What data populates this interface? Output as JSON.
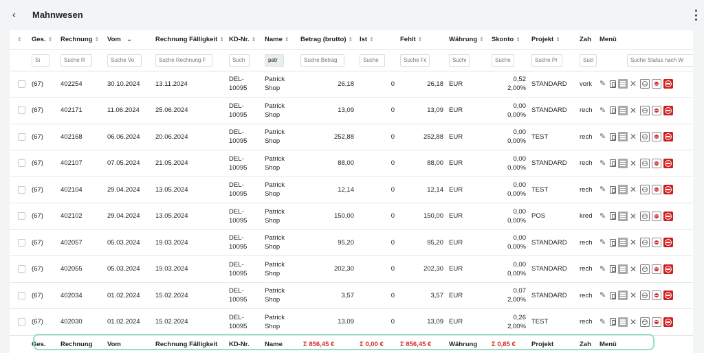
{
  "header": {
    "title": "Mahnwesen",
    "back_symbol": "‹"
  },
  "columns": {
    "ges": "Ges.",
    "rechnung": "Rechnung",
    "vom": "Vom",
    "faelligkeit": "Rechnung Fälligkeit",
    "kd": "KD-Nr.",
    "name": "Name",
    "betrag": "Betrag (brutto)",
    "ist": "Ist",
    "fehlt": "Fehlt",
    "waehrung": "Währung",
    "skonto": "Skonto",
    "projekt": "Projekt",
    "zah": "Zah",
    "menu": "Menü"
  },
  "filters": {
    "ges": "Si",
    "rechnung": "Suche R",
    "vom": "Suche Vo",
    "faelligkeit": "Suche Rechnung F",
    "kd": "Such",
    "name": "patr",
    "betrag": "Suche Betrag",
    "ist": "Suche",
    "fehlt": "Suche Fe",
    "waehrung": "Suche",
    "skonto": "Suche",
    "projekt": "Suche Pr",
    "zah": "Suche Z",
    "status": "Suche Status nach W"
  },
  "rows": [
    {
      "ges": "(67)",
      "rechnung": "402254",
      "vom": "30.10.2024",
      "faellig": "13.11.2024",
      "kd1": "DEL-",
      "kd2": "10095",
      "name1": "Patrick",
      "name2": "Shop",
      "betrag": "26,18",
      "ist": "0",
      "fehlt": "26,18",
      "waehrung": "EUR",
      "skonto1": "0,52",
      "skonto2": "2,00%",
      "projekt": "STANDARD",
      "zah": "vork"
    },
    {
      "ges": "(67)",
      "rechnung": "402171",
      "vom": "11.06.2024",
      "faellig": "25.06.2024",
      "kd1": "DEL-",
      "kd2": "10095",
      "name1": "Patrick",
      "name2": "Shop",
      "betrag": "13,09",
      "ist": "0",
      "fehlt": "13,09",
      "waehrung": "EUR",
      "skonto1": "0,00",
      "skonto2": "0,00%",
      "projekt": "STANDARD",
      "zah": "rech"
    },
    {
      "ges": "(67)",
      "rechnung": "402168",
      "vom": "06.06.2024",
      "faellig": "20.06.2024",
      "kd1": "DEL-",
      "kd2": "10095",
      "name1": "Patrick",
      "name2": "Shop",
      "betrag": "252,88",
      "ist": "0",
      "fehlt": "252,88",
      "waehrung": "EUR",
      "skonto1": "0,00",
      "skonto2": "0,00%",
      "projekt": "TEST",
      "zah": "rech"
    },
    {
      "ges": "(67)",
      "rechnung": "402107",
      "vom": "07.05.2024",
      "faellig": "21.05.2024",
      "kd1": "DEL-",
      "kd2": "10095",
      "name1": "Patrick",
      "name2": "Shop",
      "betrag": "88,00",
      "ist": "0",
      "fehlt": "88,00",
      "waehrung": "EUR",
      "skonto1": "0,00",
      "skonto2": "0,00%",
      "projekt": "STANDARD",
      "zah": "rech"
    },
    {
      "ges": "(67)",
      "rechnung": "402104",
      "vom": "29.04.2024",
      "faellig": "13.05.2024",
      "kd1": "DEL-",
      "kd2": "10095",
      "name1": "Patrick",
      "name2": "Shop",
      "betrag": "12,14",
      "ist": "0",
      "fehlt": "12,14",
      "waehrung": "EUR",
      "skonto1": "0,00",
      "skonto2": "0,00%",
      "projekt": "TEST",
      "zah": "rech"
    },
    {
      "ges": "(67)",
      "rechnung": "402102",
      "vom": "29.04.2024",
      "faellig": "13.05.2024",
      "kd1": "DEL-",
      "kd2": "10095",
      "name1": "Patrick",
      "name2": "Shop",
      "betrag": "150,00",
      "ist": "0",
      "fehlt": "150,00",
      "waehrung": "EUR",
      "skonto1": "0,00",
      "skonto2": "0,00%",
      "projekt": "POS",
      "zah": "kred"
    },
    {
      "ges": "(67)",
      "rechnung": "402057",
      "vom": "05.03.2024",
      "faellig": "19.03.2024",
      "kd1": "DEL-",
      "kd2": "10095",
      "name1": "Patrick",
      "name2": "Shop",
      "betrag": "95,20",
      "ist": "0",
      "fehlt": "95,20",
      "waehrung": "EUR",
      "skonto1": "0,00",
      "skonto2": "0,00%",
      "projekt": "STANDARD",
      "zah": "rech"
    },
    {
      "ges": "(67)",
      "rechnung": "402055",
      "vom": "05.03.2024",
      "faellig": "19.03.2024",
      "kd1": "DEL-",
      "kd2": "10095",
      "name1": "Patrick",
      "name2": "Shop",
      "betrag": "202,30",
      "ist": "0",
      "fehlt": "202,30",
      "waehrung": "EUR",
      "skonto1": "0,00",
      "skonto2": "0,00%",
      "projekt": "STANDARD",
      "zah": "rech"
    },
    {
      "ges": "(67)",
      "rechnung": "402034",
      "vom": "01.02.2024",
      "faellig": "15.02.2024",
      "kd1": "DEL-",
      "kd2": "10095",
      "name1": "Patrick",
      "name2": "Shop",
      "betrag": "3,57",
      "ist": "0",
      "fehlt": "3,57",
      "waehrung": "EUR",
      "skonto1": "0,07",
      "skonto2": "2,00%",
      "projekt": "STANDARD",
      "zah": "rech"
    },
    {
      "ges": "(67)",
      "rechnung": "402030",
      "vom": "01.02.2024",
      "faellig": "15.02.2024",
      "kd1": "DEL-",
      "kd2": "10095",
      "name1": "Patrick",
      "name2": "Shop",
      "betrag": "13,09",
      "ist": "0",
      "fehlt": "13,09",
      "waehrung": "EUR",
      "skonto1": "0,26",
      "skonto2": "2,00%",
      "projekt": "TEST",
      "zah": "rech"
    }
  ],
  "footer": {
    "ges": "Ges.",
    "rechnung": "Rechnung",
    "vom": "Vom",
    "faelligkeit": "Rechnung Fälligkeit",
    "kd": "KD-Nr.",
    "name": "Name",
    "betrag_sum": "Σ 856,45 €",
    "ist_sum": "Σ 0,00 €",
    "fehlt_sum": "Σ 856,45 €",
    "waehrung": "Währung",
    "skonto_sum": "Σ 0,85 €",
    "projekt": "Projekt",
    "zah": "Zah",
    "menu": "Menü"
  },
  "colors": {
    "sum_red": "#d42a2a",
    "highlight": "#8fe0c6",
    "stop_red": "#c8201f"
  },
  "row_icons": [
    "pencil-icon",
    "pdf-icon",
    "pdf-print-icon",
    "close-icon",
    "minus-gray-icon",
    "minus-red-icon",
    "stop-icon"
  ]
}
